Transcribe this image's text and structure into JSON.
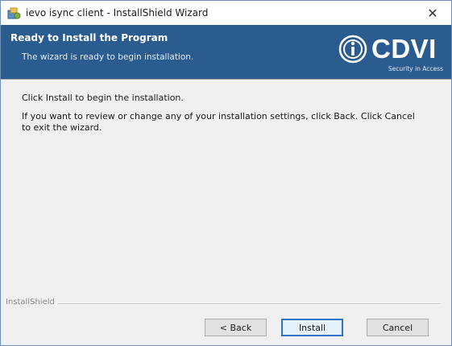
{
  "window": {
    "title": "ievo isync client - InstallShield Wizard",
    "close_glyph": "✕"
  },
  "banner": {
    "title": "Ready to Install the Program",
    "subtitle": "The wizard is ready to begin installation.",
    "logo": {
      "brand": "CDVI",
      "tagline": "Security in Access"
    },
    "colors": {
      "background": "#2b5c8f",
      "text": "#ffffff"
    }
  },
  "content": {
    "line1": "Click Install to begin the installation.",
    "line2": "If you want to review or change any of your installation settings, click Back. Click Cancel to exit the wizard."
  },
  "footer": {
    "label": "InstallShield",
    "buttons": {
      "back": "< Back",
      "install": "Install",
      "cancel": "Cancel"
    }
  },
  "icons": {
    "app": "installer-icon",
    "close": "close-icon",
    "logo_mark": "cdvi-logo-icon"
  }
}
